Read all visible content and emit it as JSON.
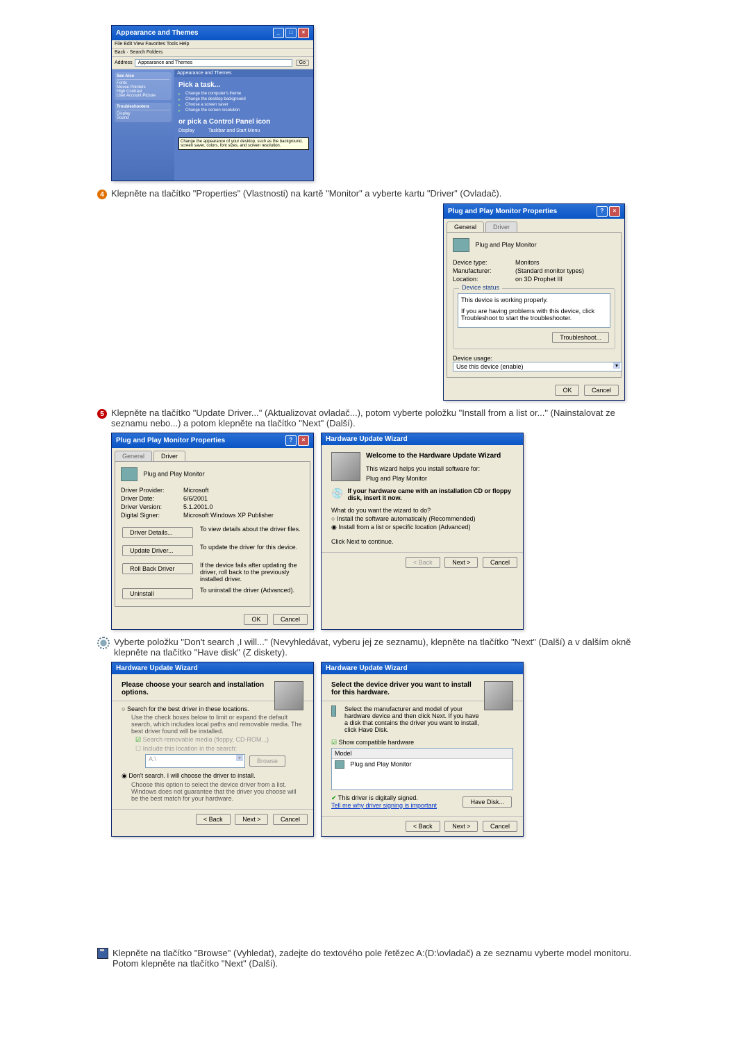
{
  "xp": {
    "title": "Appearance and Themes",
    "menu": "File  Edit  View  Favorites  Tools  Help",
    "toolbar": "Back  ·      Search    Folders",
    "address": "Appearance and Themes",
    "go": "Go",
    "side": {
      "box1_h": "See Also",
      "box1_items": [
        "Fonts",
        "Mouse Pointers",
        "High Contrast",
        "User Account Picture"
      ],
      "box2_h": "Troubleshooters",
      "box2_items": [
        "Display",
        "Sound"
      ]
    },
    "main": {
      "header": "Appearance and Themes",
      "pick_task": "Pick a task...",
      "tasks": [
        "Change the computer's theme",
        "Change the desktop background",
        "Choose a screen saver",
        "Change the screen resolution"
      ],
      "pick_icon": "or pick a Control Panel icon",
      "icons": [
        "Display",
        "Taskbar and Start Menu"
      ],
      "tooltip": "Change the appearance of your desktop, such as the background, screen saver, colors, font sizes, and screen resolution."
    }
  },
  "step4": "Klepněte na tlačítko \"Properties\" (Vlastnosti) na kartě \"Monitor\" a vyberte kartu \"Driver\" (Ovladač).",
  "props_general": {
    "title": "Plug and Play Monitor Properties",
    "tab_general": "General",
    "tab_driver": "Driver",
    "name": "Plug and Play Monitor",
    "k_type": "Device type:",
    "v_type": "Monitors",
    "k_manu": "Manufacturer:",
    "v_manu": "(Standard monitor types)",
    "k_loc": "Location:",
    "v_loc": "on 3D Prophet III",
    "grp": "Device status",
    "line1": "This device is working properly.",
    "line2": "If you are having problems with this device, click Troubleshoot to start the troubleshooter.",
    "btn_trouble": "Troubleshoot...",
    "usage_lbl": "Device usage:",
    "usage_val": "Use this device (enable)",
    "ok": "OK",
    "cancel": "Cancel"
  },
  "step5": "Klepněte na tlačítko \"Update Driver...\" (Aktualizovat ovladač...), potom vyberte položku \"Install from a list or...\" (Nainstalovat ze seznamu nebo...) a potom klepněte na tlačítko \"Next\" (Další).",
  "props_driver": {
    "title": "Plug and Play Monitor Properties",
    "tab_general": "General",
    "tab_driver": "Driver",
    "name": "Plug and Play Monitor",
    "k_prov": "Driver Provider:",
    "v_prov": "Microsoft",
    "k_date": "Driver Date:",
    "v_date": "6/6/2001",
    "k_ver": "Driver Version:",
    "v_ver": "5.1.2001.0",
    "k_sign": "Digital Signer:",
    "v_sign": "Microsoft Windows XP Publisher",
    "btn_details": "Driver Details...",
    "desc_details": "To view details about the driver files.",
    "btn_update": "Update Driver...",
    "desc_update": "To update the driver for this device.",
    "btn_roll": "Roll Back Driver",
    "desc_roll": "If the device fails after updating the driver, roll back to the previously installed driver.",
    "btn_uninst": "Uninstall",
    "desc_uninst": "To uninstall the driver (Advanced).",
    "ok": "OK",
    "cancel": "Cancel"
  },
  "wiz1": {
    "title": "Hardware Update Wizard",
    "h": "Welcome to the Hardware Update Wizard",
    "p1": "This wizard helps you install software for:",
    "dev": "Plug and Play Monitor",
    "cd": "If your hardware came with an installation CD or floppy disk, insert it now.",
    "q": "What do you want the wizard to do?",
    "opt1": "Install the software automatically (Recommended)",
    "opt2": "Install from a list or specific location (Advanced)",
    "cont": "Click Next to continue.",
    "back": "< Back",
    "next": "Next >",
    "cancel": "Cancel"
  },
  "step6": "Vyberte položku \"Don't search ,I will...\" (Nevyhledávat, vyberu jej ze seznamu), klepněte na tlačítko \"Next\" (Další) a v dalším okně klepněte na tlačítko \"Have disk\" (Z diskety).",
  "wiz2": {
    "title": "Hardware Update Wizard",
    "h": "Please choose your search and installation options.",
    "opt1": "Search for the best driver in these locations.",
    "opt1_desc": "Use the check boxes below to limit or expand the default search, which includes local paths and removable media. The best driver found will be installed.",
    "chk1": "Search removable media (floppy, CD-ROM...)",
    "chk2": "Include this location in the search:",
    "path": "A:\\",
    "browse": "Browse",
    "opt2": "Don't search. I will choose the driver to install.",
    "opt2_desc": "Choose this option to select the device driver from a list. Windows does not guarantee that the driver you choose will be the best match for your hardware.",
    "back": "< Back",
    "next": "Next >",
    "cancel": "Cancel"
  },
  "wiz3": {
    "title": "Hardware Update Wizard",
    "h": "Select the device driver you want to install for this hardware.",
    "p": "Select the manufacturer and model of your hardware device and then click Next. If you have a disk that contains the driver you want to install, click Have Disk.",
    "chk": "Show compatible hardware",
    "model_lbl": "Model",
    "model": "Plug and Play Monitor",
    "signed": "This driver is digitally signed.",
    "tell": "Tell me why driver signing is important",
    "have": "Have Disk...",
    "back": "< Back",
    "next": "Next >",
    "cancel": "Cancel"
  },
  "final": "Klepněte na tlačítko \"Browse\" (Vyhledat), zadejte do textového pole řetězec A:(D:\\ovladač) a ze seznamu vyberte model monitoru. Potom klepněte na tlačítko \"Next\" (Další)."
}
